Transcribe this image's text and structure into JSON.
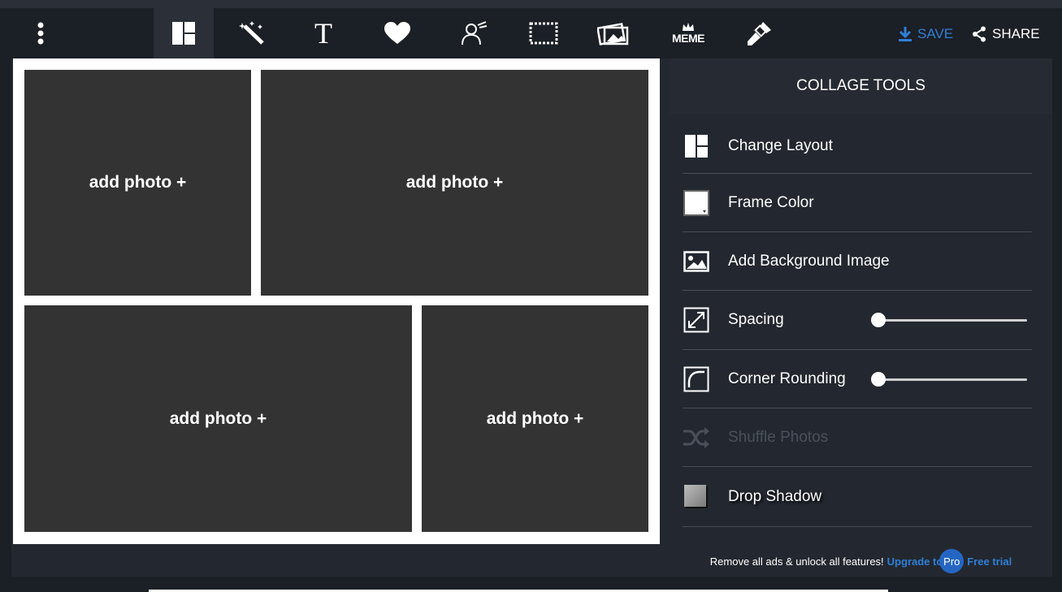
{
  "toolbar": {
    "tools": [
      {
        "name": "collage-layout-icon",
        "active": true
      },
      {
        "name": "magic-wand-icon",
        "active": false
      },
      {
        "name": "text-icon",
        "label": "T",
        "active": false
      },
      {
        "name": "heart-icon",
        "active": false
      },
      {
        "name": "cartoon-person-icon",
        "active": false
      },
      {
        "name": "frame-icon",
        "active": false
      },
      {
        "name": "photo-overlay-icon",
        "active": false
      },
      {
        "name": "meme-icon",
        "label": "MEME",
        "active": false
      },
      {
        "name": "paint-brush-icon",
        "active": false
      }
    ],
    "save_label": "SAVE",
    "share_label": "SHARE"
  },
  "canvas": {
    "cells": [
      {
        "label": "add photo +"
      },
      {
        "label": "add photo +"
      },
      {
        "label": "add photo +"
      },
      {
        "label": "add photo +"
      }
    ]
  },
  "panel": {
    "title": "COLLAGE TOOLS",
    "items": [
      {
        "label": "Change Layout",
        "icon": "layout-icon"
      },
      {
        "label": "Frame Color",
        "icon": "color-swatch-icon"
      },
      {
        "label": "Add Background Image",
        "icon": "image-icon"
      },
      {
        "label": "Spacing",
        "icon": "expand-arrows-icon",
        "slider_value": 0
      },
      {
        "label": "Corner Rounding",
        "icon": "corner-rounding-icon",
        "slider_value": 0
      },
      {
        "label": "Shuffle Photos",
        "icon": "shuffle-icon",
        "disabled": true
      },
      {
        "label": "Drop Shadow",
        "icon": "shadow-square-icon"
      }
    ],
    "promo": {
      "text": "Remove all ads & unlock all features!",
      "upgrade": "Upgrade to",
      "badge": "Pro",
      "trial": "Free trial"
    }
  },
  "colors": {
    "background": "#1b1f26",
    "panel": "#232830",
    "cell": "#333333",
    "accent": "#2f7fd6"
  }
}
